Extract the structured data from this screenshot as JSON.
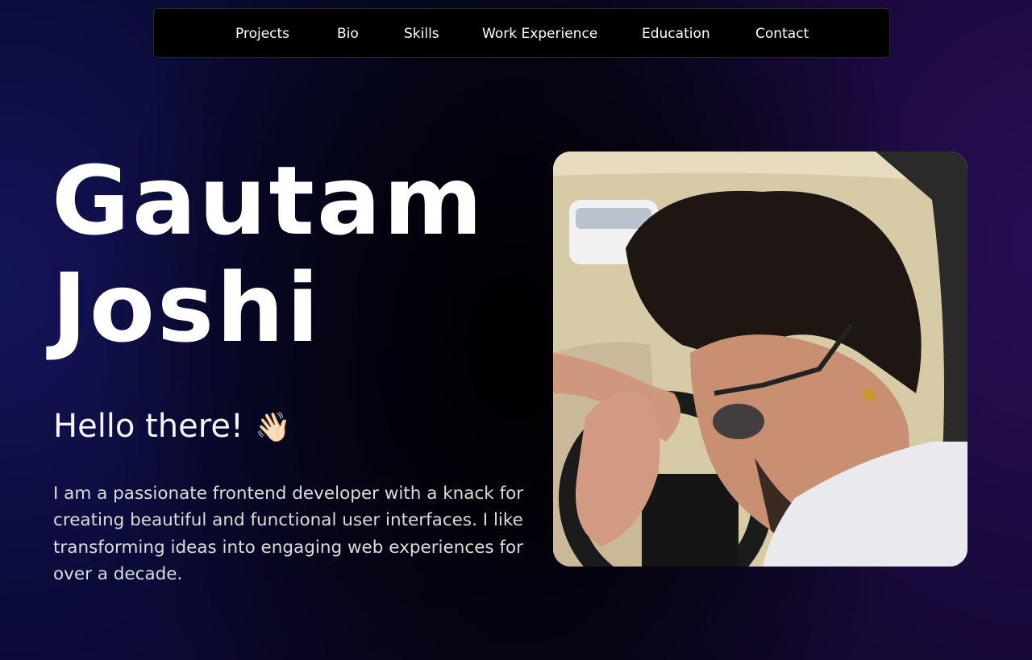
{
  "nav": {
    "items": [
      "Projects",
      "Bio",
      "Skills",
      "Work Experience",
      "Education",
      "Contact"
    ]
  },
  "hero": {
    "first_name": "Gautam",
    "last_name": "Joshi",
    "greeting": "Hello there!",
    "greeting_emoji": "👋🏻",
    "bio": "I am a passionate frontend developer with a knack for creating beautiful and functional user interfaces. I like transforming ideas into engaging web experiences for over a decade."
  },
  "profile_photo": {
    "icon": "profile-photo"
  }
}
